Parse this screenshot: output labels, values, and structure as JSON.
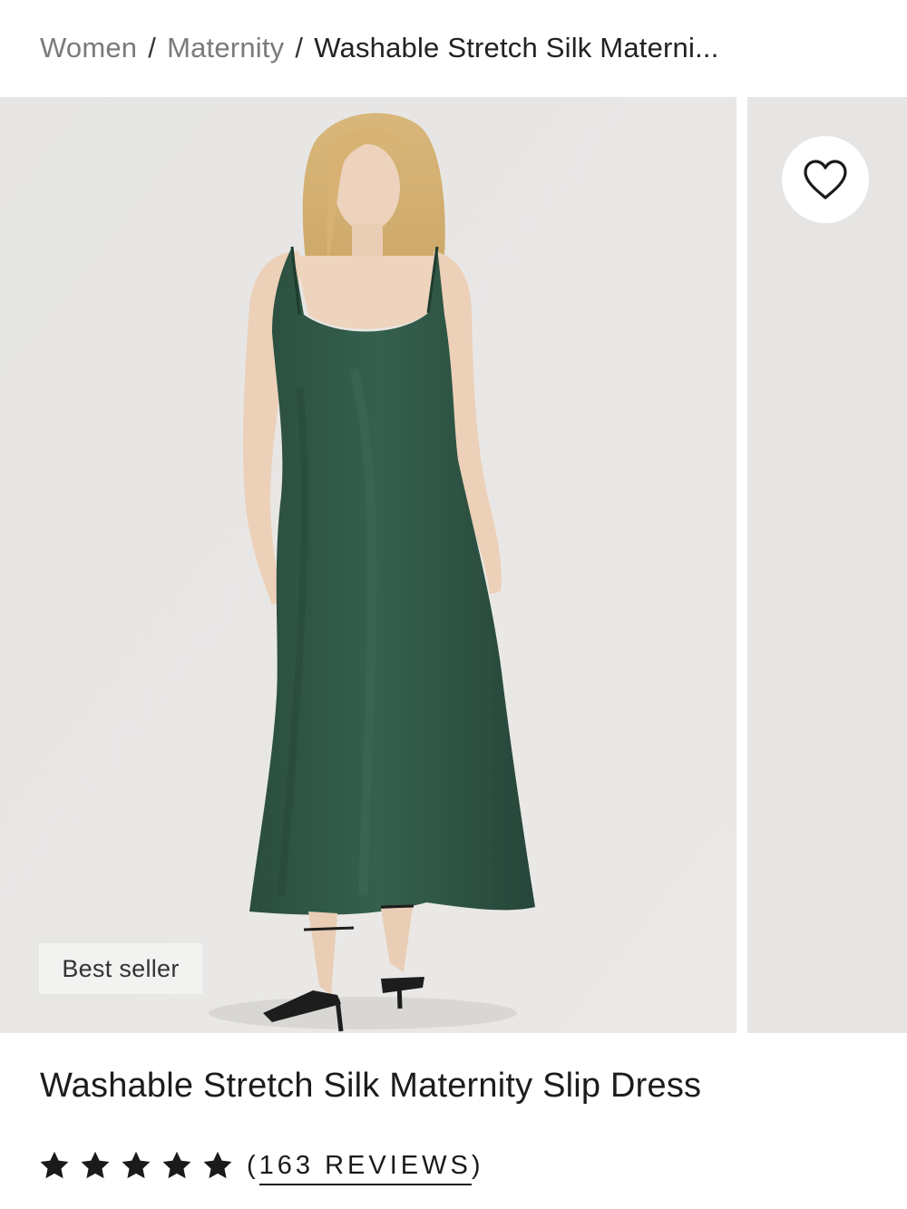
{
  "breadcrumb": {
    "items": [
      "Women",
      "Maternity"
    ],
    "separator": "/",
    "current": "Washable Stretch Silk Materni..."
  },
  "gallery": {
    "badge": "Best seller",
    "heart_icon": "heart-outline-icon"
  },
  "product": {
    "title": "Washable Stretch Silk Maternity Slip Dress",
    "rating": {
      "stars": 5,
      "reviews_open": "(",
      "reviews_count_text": "163 REVIEWS",
      "reviews_close": ")"
    }
  },
  "colors": {
    "dress": "#2f5444",
    "background": "#e8e7e6",
    "breadcrumb_link": "#7a7a7a",
    "text": "#1a1a1a"
  }
}
